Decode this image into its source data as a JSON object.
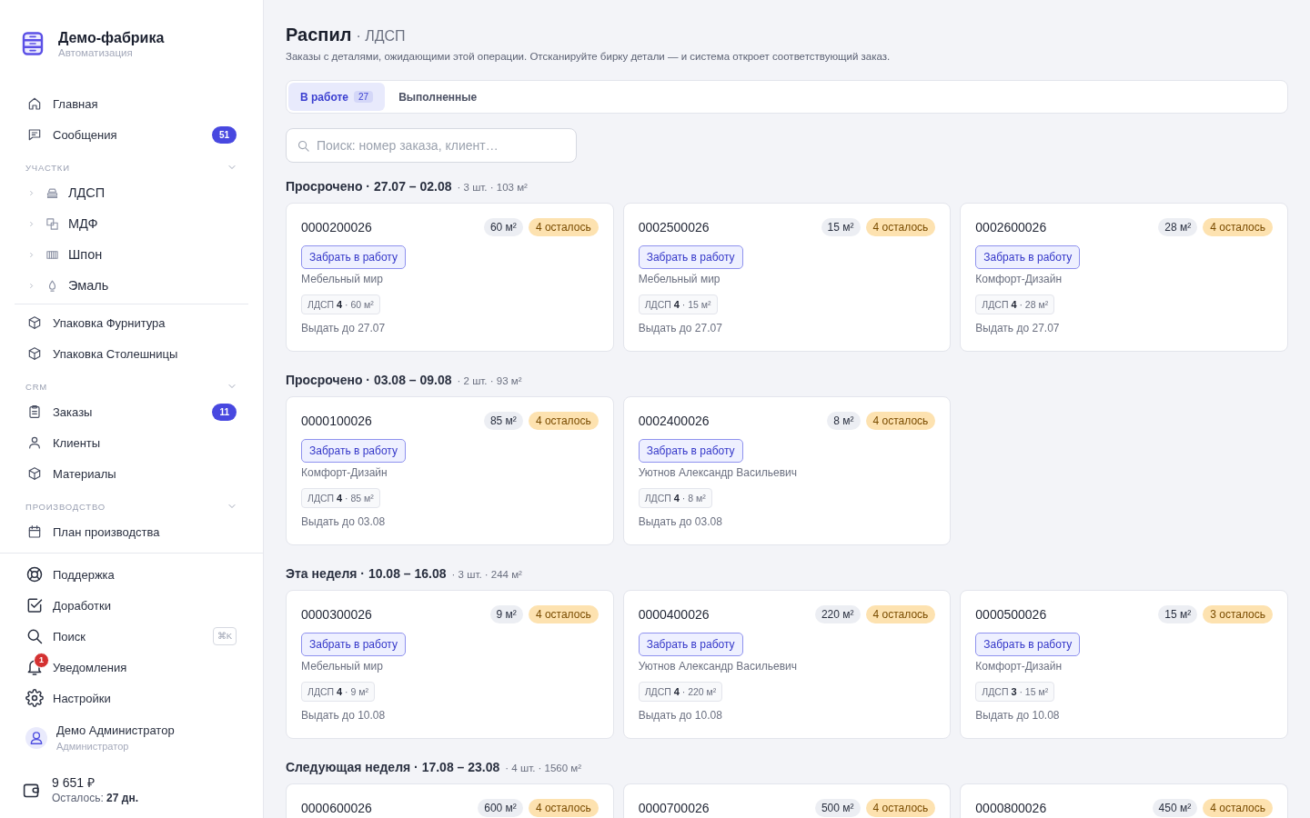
{
  "sidebar": {
    "brand": {
      "title": "Демо-фабрика",
      "subtitle": "Автоматизация"
    },
    "nav": [
      {
        "label": "Главная",
        "selected": false
      },
      {
        "label": "Сообщения",
        "badge": "51",
        "selected": false
      }
    ],
    "areas": {
      "title": "УЧАСТКИ",
      "expanded": true,
      "items": [
        {
          "label": "ЛДСП",
          "expanded": false,
          "selected": false
        },
        {
          "label": "МДФ",
          "expanded": false,
          "selected": false
        },
        {
          "label": "Шпон",
          "expanded": false,
          "selected": false
        },
        {
          "label": "Эмаль",
          "expanded": false,
          "selected": false
        }
      ]
    },
    "packing": [
      {
        "label": "Упаковка Фурнитура",
        "selected": false
      },
      {
        "label": "Упаковка Столешницы",
        "selected": false
      }
    ],
    "sections": [
      {
        "title": "CRM",
        "expanded": true,
        "items": [
          {
            "label": "Заказы",
            "badge": "11",
            "selected": false
          },
          {
            "label": "Клиенты",
            "selected": false
          },
          {
            "label": "Материалы",
            "selected": false
          }
        ]
      },
      {
        "title": "ПРОИЗВОДСТВО",
        "expanded": true,
        "items": [
          {
            "label": "План производства",
            "selected": false
          }
        ]
      }
    ],
    "footer_nav": [
      {
        "label": "Поддержка",
        "selected": false
      },
      {
        "label": "Доработки",
        "selected": false
      },
      {
        "label": "Поиск",
        "shortcut": "⌘K",
        "selected": false
      },
      {
        "label": "Уведомления",
        "badge": "1",
        "selected": false
      },
      {
        "label": "Настройки",
        "selected": false
      }
    ],
    "user": {
      "name": "Демо Администратор",
      "role": "Администратор"
    },
    "balance": {
      "amount": "9 651 ₽",
      "note": "Осталось: **27 дн.**"
    }
  },
  "main": {
    "title": "Распил",
    "subtitle": "· ЛДСП",
    "description": "Заказы с деталями, ожидающими этой операции. Отсканируйте бирку детали — и система откроет соответствующий заказ.",
    "tabs": [
      {
        "label": "В работе",
        "count": "27",
        "selected": true
      },
      {
        "label": "Выполненные",
        "selected": false
      }
    ],
    "search": {
      "placeholder": "Поиск: номер заказа, клиент…"
    },
    "groups": [
      {
        "title": "Просрочено · 27.07 – 02.08",
        "summary": "· 3 шт. · 103 м²",
        "orders": [
          {
            "number": "0000200026",
            "area": "60 м²",
            "remaining": "4 осталось",
            "action": "Забрать в работу",
            "client": "Мебельный мир",
            "material": "ЛДСП **4** · 60 м²",
            "due": "Выдать до 27.07"
          },
          {
            "number": "0002500026",
            "area": "15 м²",
            "remaining": "4 осталось",
            "action": "Забрать в работу",
            "client": "Мебельный мир",
            "material": "ЛДСП **4** · 15 м²",
            "due": "Выдать до 27.07"
          },
          {
            "number": "0002600026",
            "area": "28 м²",
            "remaining": "4 осталось",
            "action": "Забрать в работу",
            "client": "Комфорт-Дизайн",
            "material": "ЛДСП **4** · 28 м²",
            "due": "Выдать до 27.07"
          }
        ]
      },
      {
        "title": "Просрочено · 03.08 – 09.08",
        "summary": "· 2 шт. · 93 м²",
        "orders": [
          {
            "number": "0000100026",
            "area": "85 м²",
            "remaining": "4 осталось",
            "action": "Забрать в работу",
            "client": "Комфорт-Дизайн",
            "material": "ЛДСП **4** · 85 м²",
            "due": "Выдать до 03.08"
          },
          {
            "number": "0002400026",
            "area": "8 м²",
            "remaining": "4 осталось",
            "action": "Забрать в работу",
            "client": "Уютнов Александр Васильевич",
            "material": "ЛДСП **4** · 8 м²",
            "due": "Выдать до 03.08"
          }
        ]
      },
      {
        "title": "Эта неделя · 10.08 – 16.08",
        "summary": "· 3 шт. · 244 м²",
        "orders": [
          {
            "number": "0000300026",
            "area": "9 м²",
            "remaining": "4 осталось",
            "action": "Забрать в работу",
            "client": "Мебельный мир",
            "material": "ЛДСП **4** · 9 м²",
            "due": "Выдать до 10.08"
          },
          {
            "number": "0000400026",
            "area": "220 м²",
            "remaining": "4 осталось",
            "action": "Забрать в работу",
            "client": "Уютнов Александр Васильевич",
            "material": "ЛДСП **4** · 220 м²",
            "due": "Выдать до 10.08"
          },
          {
            "number": "0000500026",
            "area": "15 м²",
            "remaining": "3 осталось",
            "action": "Забрать в работу",
            "client": "Комфорт-Дизайн",
            "material": "ЛДСП **3** · 15 м²",
            "due": "Выдать до 10.08"
          }
        ]
      },
      {
        "title": "Следующая неделя · 17.08 – 23.08",
        "summary": "· 4 шт. · 1560 м²",
        "orders": [
          {
            "number": "0000600026",
            "area": "600 м²",
            "remaining": "4 осталось"
          },
          {
            "number": "0000700026",
            "area": "500 м²",
            "remaining": "4 осталось"
          },
          {
            "number": "0000800026",
            "area": "450 м²",
            "remaining": "4 осталось"
          }
        ]
      }
    ]
  }
}
